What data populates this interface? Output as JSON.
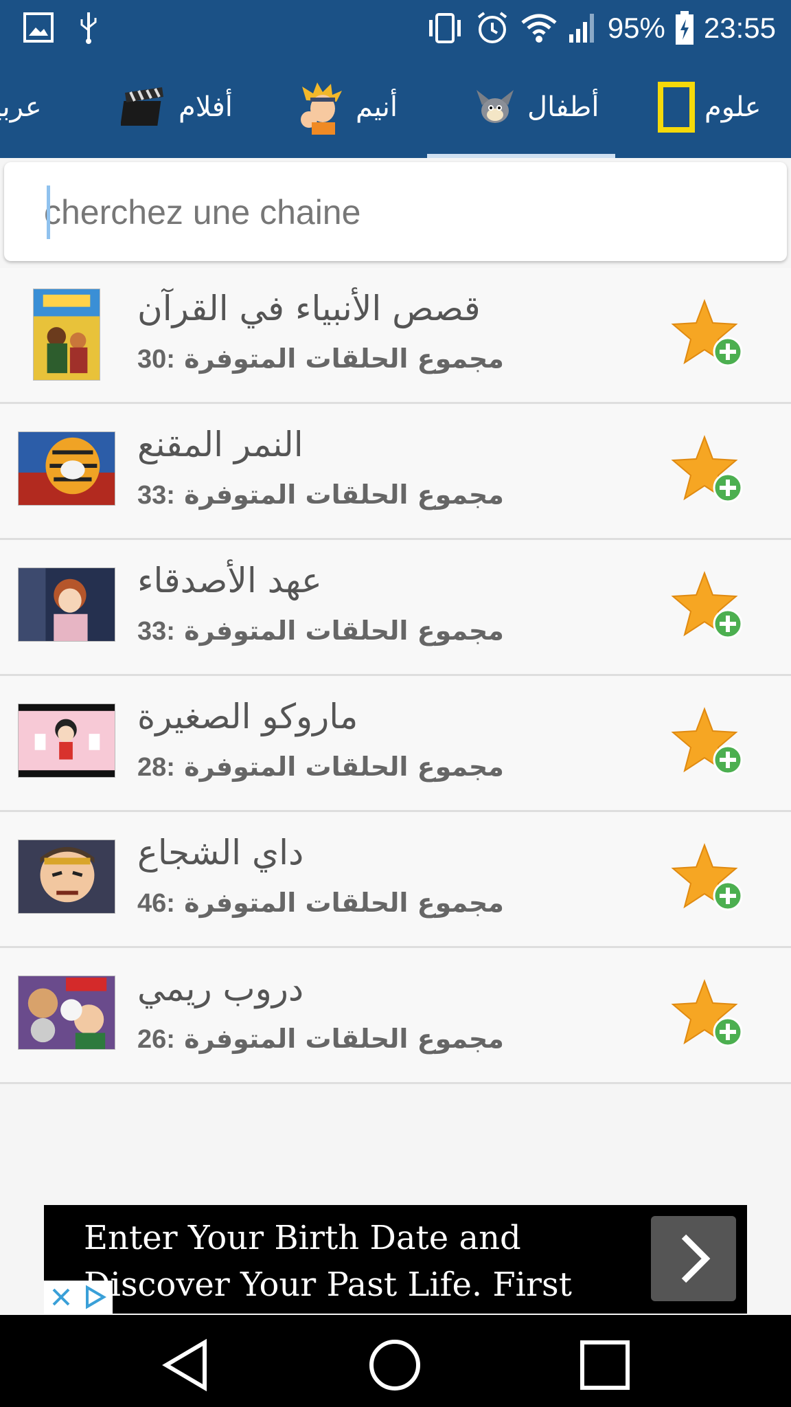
{
  "status_bar": {
    "battery": "95%",
    "time": "23:55",
    "icons": [
      "image-icon",
      "usb-icon",
      "vibrate-icon",
      "alarm-icon",
      "wifi-icon",
      "signal-icon",
      "battery-charging-icon"
    ]
  },
  "tabs": [
    {
      "label": "علوم",
      "icon": "yellow-frame-logo"
    },
    {
      "label": "أطفال",
      "icon": "cartoon-cat-image",
      "selected": true
    },
    {
      "label": "أنيم",
      "icon": "anime-character-image"
    },
    {
      "label": "أفلام",
      "icon": "clapperboard-image"
    },
    {
      "label": "عربية",
      "icon": ""
    }
  ],
  "search": {
    "placeholder": "cherchez une chaine",
    "value": ""
  },
  "list": {
    "subtitle_prefix": "مجموع الحلقات المتوفرة",
    "items": [
      {
        "title": "قصص الأنبياء في القرآن",
        "count": "30:"
      },
      {
        "title": "النمر المقنع",
        "count": "33:"
      },
      {
        "title": "عهد الأصدقاء",
        "count": "33:"
      },
      {
        "title": "ماروكو الصغيرة",
        "count": "28:"
      },
      {
        "title": "داي الشجاع",
        "count": "46:"
      },
      {
        "title": "دروب ريمي",
        "count": "26:"
      }
    ]
  },
  "ad": {
    "text": "Enter Your Birth Date and Discover Your Past Life. First Reading Free!"
  },
  "colors": {
    "primary": "#1b5186",
    "star": "#f6a623",
    "plus": "#4caf50"
  }
}
